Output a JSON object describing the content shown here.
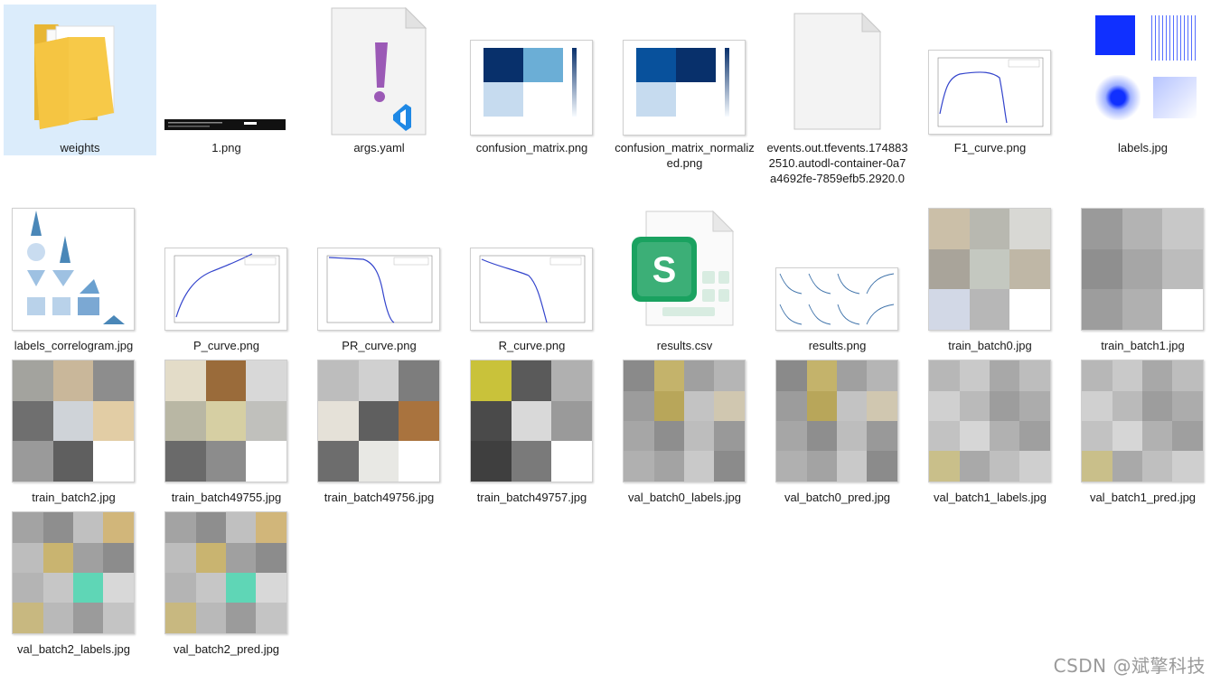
{
  "files": [
    {
      "name": "weights",
      "icon": "folder-icon",
      "selected": true
    },
    {
      "name": "1.png",
      "icon": "terminal-image-thumbnail"
    },
    {
      "name": "args.yaml",
      "icon": "yaml-file-icon"
    },
    {
      "name": "confusion_matrix.png",
      "icon": "confusion-matrix-thumbnail"
    },
    {
      "name": "confusion_matrix_normalized.png",
      "icon": "confusion-matrix-thumbnail"
    },
    {
      "name": "events.out.tfevents.1748832510.autodl-container-0a7a4692fe-7859efb5.2920.0",
      "icon": "blank-file-icon"
    },
    {
      "name": "F1_curve.png",
      "icon": "curve-chart-thumbnail"
    },
    {
      "name": "labels.jpg",
      "icon": "labels-plot-thumbnail"
    },
    {
      "name": "labels_correlogram.jpg",
      "icon": "correlogram-thumbnail"
    },
    {
      "name": "P_curve.png",
      "icon": "curve-chart-thumbnail"
    },
    {
      "name": "PR_curve.png",
      "icon": "curve-chart-thumbnail"
    },
    {
      "name": "R_curve.png",
      "icon": "curve-chart-thumbnail"
    },
    {
      "name": "results.csv",
      "icon": "spreadsheet-file-icon"
    },
    {
      "name": "results.png",
      "icon": "results-grid-thumbnail"
    },
    {
      "name": "train_batch0.jpg",
      "icon": "image-mosaic-thumbnail"
    },
    {
      "name": "train_batch1.jpg",
      "icon": "image-mosaic-thumbnail"
    },
    {
      "name": "train_batch2.jpg",
      "icon": "image-mosaic-thumbnail"
    },
    {
      "name": "train_batch49755.jpg",
      "icon": "image-mosaic-thumbnail"
    },
    {
      "name": "train_batch49756.jpg",
      "icon": "image-mosaic-thumbnail"
    },
    {
      "name": "train_batch49757.jpg",
      "icon": "image-mosaic-thumbnail"
    },
    {
      "name": "val_batch0_labels.jpg",
      "icon": "image-mosaic-thumbnail"
    },
    {
      "name": "val_batch0_pred.jpg",
      "icon": "image-mosaic-thumbnail"
    },
    {
      "name": "val_batch1_labels.jpg",
      "icon": "image-mosaic-thumbnail"
    },
    {
      "name": "val_batch1_pred.jpg",
      "icon": "image-mosaic-thumbnail"
    },
    {
      "name": "val_batch2_labels.jpg",
      "icon": "image-mosaic-thumbnail"
    },
    {
      "name": "val_batch2_pred.jpg",
      "icon": "image-mosaic-thumbnail"
    }
  ],
  "watermark": "CSDN @斌擎科技",
  "colors": {
    "selection": "#dbecfb",
    "folder": "#f5c542",
    "yaml_mark": "#9b59b6",
    "vscode_blue": "#1e88e5",
    "spreadsheet_green": "#1aa260",
    "matrix_dark": "#08306b",
    "matrix_mid": "#6baed6",
    "matrix_light": "#c6dbef",
    "curve_line": "#3344cc"
  }
}
